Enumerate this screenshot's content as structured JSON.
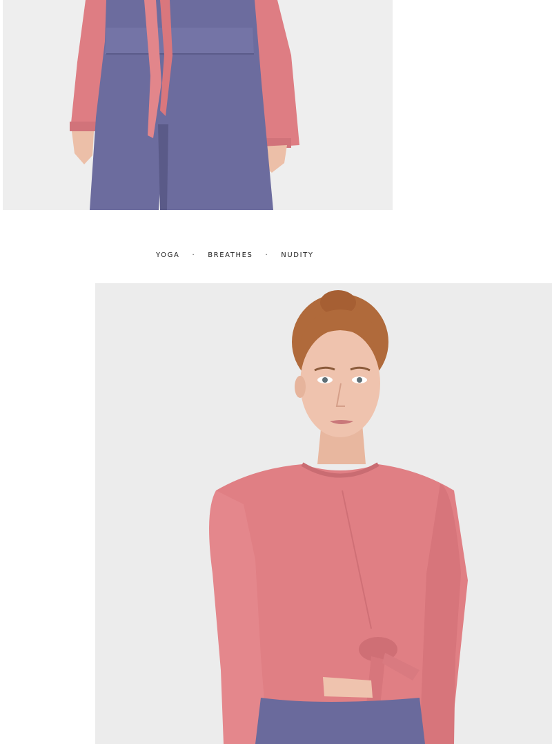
{
  "tagline": {
    "words": [
      "YOGA",
      "BREATHES",
      "NUDITY"
    ],
    "separator": "·"
  },
  "colors": {
    "background": "#ffffff",
    "photo_backdrop": "#ededed",
    "top_pink": "#e07f84",
    "legging_purple": "#6a6a9c",
    "hair": "#b36a3a",
    "skin": "#efc3ae"
  },
  "images": {
    "top": "product-photo-torso-closeup",
    "main": "product-photo-model-portrait"
  }
}
